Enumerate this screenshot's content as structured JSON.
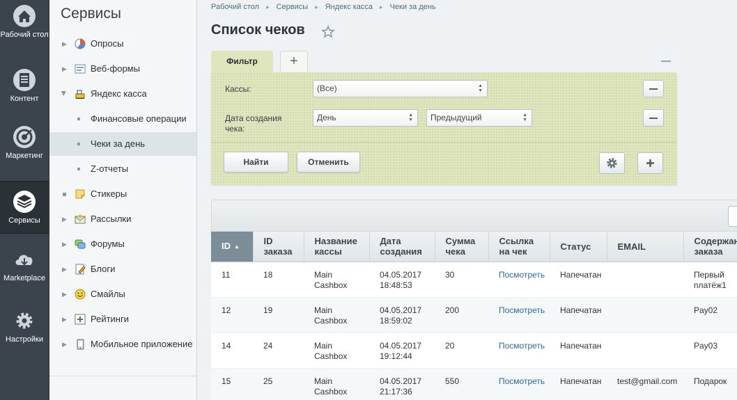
{
  "rail": [
    {
      "icon": "home-icon",
      "label": "Рабочий стол"
    },
    {
      "icon": "content-icon",
      "label": "Контент"
    },
    {
      "icon": "target-icon",
      "label": "Маркетинг"
    },
    {
      "icon": "layers-icon",
      "label": "Сервисы",
      "active": true
    },
    {
      "icon": "cloud-download-icon",
      "label": "Marketplace"
    },
    {
      "icon": "gear-icon",
      "label": "Настройки"
    }
  ],
  "menu": {
    "title": "Сервисы",
    "items": [
      {
        "label": "Опросы",
        "icon": "pie-chart-icon"
      },
      {
        "label": "Веб-формы",
        "icon": "web-forms-icon"
      },
      {
        "label": "Яндекс касса",
        "icon": "cash-register-icon",
        "expanded": true
      },
      {
        "label": "Финансовые операции",
        "sub": true
      },
      {
        "label": "Чеки за день",
        "sub": true,
        "selected": true
      },
      {
        "label": "Z-отчеты",
        "sub": true
      },
      {
        "label": "Стикеры",
        "icon": "sticker-icon"
      },
      {
        "label": "Рассылки",
        "icon": "mail-icon"
      },
      {
        "label": "Форумы",
        "icon": "forum-icon"
      },
      {
        "label": "Блоги",
        "icon": "blog-icon"
      },
      {
        "label": "Смайлы",
        "icon": "smile-icon"
      },
      {
        "label": "Рейтинги",
        "icon": "rating-icon"
      },
      {
        "label": "Мобильное приложение",
        "icon": "mobile-app-icon"
      }
    ]
  },
  "breadcrumbs": [
    "Рабочий стол",
    "Сервисы",
    "Яндекс касса",
    "Чеки за день"
  ],
  "page_title": "Список чеков",
  "filter": {
    "tab_label": "Фильтр",
    "kassy_label": "Кассы:",
    "kassy_value": "(Все)",
    "date_label_line1": "Дата создания",
    "date_label_line2": "чека:",
    "date_period_value": "День",
    "date_direction_value": "Предыдущий",
    "find_label": "Найти",
    "cancel_label": "Отменить"
  },
  "grid": {
    "columns": [
      [
        "ID"
      ],
      [
        "ID",
        "заказа"
      ],
      [
        "Название",
        "кассы"
      ],
      [
        "Дата",
        "создания"
      ],
      [
        "Сумма",
        "чека"
      ],
      [
        "Ссылка",
        "на чек"
      ],
      [
        "Статус"
      ],
      [
        "EMAIL"
      ],
      [
        "Содержание",
        "заказа"
      ]
    ],
    "rows": [
      {
        "id": "11",
        "order_id": "18",
        "cashbox": [
          "Main",
          "Cashbox"
        ],
        "date": [
          "04.05.2017",
          "18:48:53"
        ],
        "sum": "30",
        "link": "Посмотреть",
        "status": "Напечатан",
        "email": "",
        "content": [
          "Первый",
          "платёж1"
        ]
      },
      {
        "id": "12",
        "order_id": "19",
        "cashbox": [
          "Main",
          "Cashbox"
        ],
        "date": [
          "04.05.2017",
          "18:59:02"
        ],
        "sum": "200",
        "link": "Посмотреть",
        "status": "Напечатан",
        "email": "",
        "content": [
          "Pay02",
          ""
        ]
      },
      {
        "id": "14",
        "order_id": "24",
        "cashbox": [
          "Main",
          "Cashbox"
        ],
        "date": [
          "04.05.2017",
          "19:12:44"
        ],
        "sum": "20",
        "link": "Посмотреть",
        "status": "Напечатан",
        "email": "",
        "content": [
          "Pay03",
          ""
        ]
      },
      {
        "id": "15",
        "order_id": "25",
        "cashbox": [
          "Main",
          "Cashbox"
        ],
        "date": [
          "04.05.2017",
          "21:17:36"
        ],
        "sum": "550",
        "link": "Посмотреть",
        "status": "Напечатан",
        "email": "test@gmail.com",
        "content": [
          "Подарок",
          ""
        ]
      }
    ]
  },
  "colors": {
    "filter_bg": "#dfe6be",
    "rail_bg": "#3b444c",
    "sorted_header": "#7d8d98",
    "link": "#2d66a5"
  }
}
